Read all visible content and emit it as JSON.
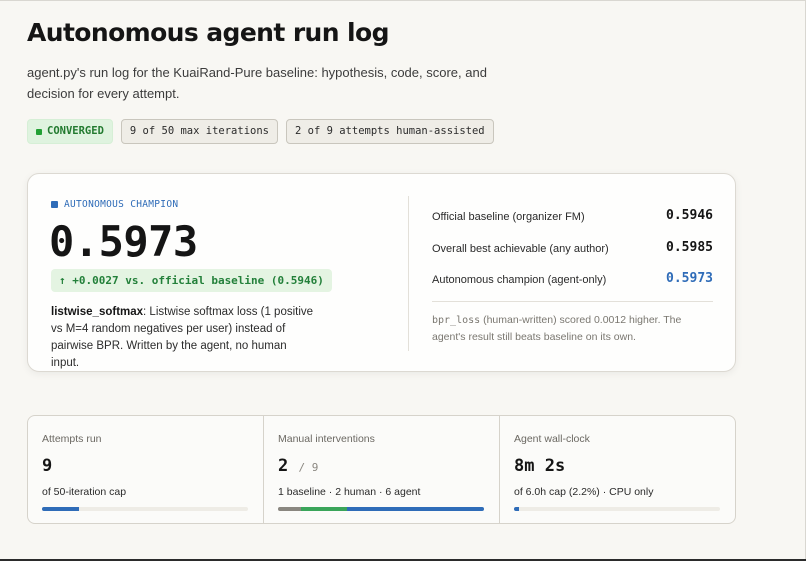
{
  "title": "Autonomous agent run log",
  "subtitle": "agent.py's run log for the KuaiRand-Pure baseline: hypothesis, code, score, and decision for every attempt.",
  "badges": {
    "status": "CONVERGED",
    "iterations": "9 of 50 max iterations",
    "human_assisted": "2 of 9 attempts human-assisted"
  },
  "champion": {
    "label": "AUTONOMOUS CHAMPION",
    "value": "0.5973",
    "delta": "↑ +0.0027 vs. official baseline (0.5946)",
    "method_name": "listwise_softmax",
    "method_desc": ": Listwise softmax loss (1 positive vs M=4 random negatives per user) instead of pairwise BPR. Written by the agent, no human input."
  },
  "comparison": [
    {
      "label": "Official baseline (organizer FM)",
      "value": "0.5946"
    },
    {
      "label": "Overall best achievable (any author)",
      "value": "0.5985"
    },
    {
      "label": "Autonomous champion (agent-only)",
      "value": "0.5973"
    }
  ],
  "note": {
    "code": "bpr_loss",
    "text": " (human-written) scored 0.0012 higher. The agent's result still beats baseline on its own."
  },
  "stats": {
    "attempts": {
      "label": "Attempts run",
      "value": "9",
      "sub": "of 50-iteration cap",
      "progress": 0.18
    },
    "interventions": {
      "label": "Manual interventions",
      "value": "2",
      "of": "/ 9",
      "sub": "1 baseline · 2 human · 6 agent",
      "segments": [
        {
          "name": "baseline",
          "fraction": 0.111,
          "color": "#8a8780"
        },
        {
          "name": "human",
          "fraction": 0.222,
          "color": "#3aa55a"
        },
        {
          "name": "agent",
          "fraction": 0.667,
          "color": "#2f6cb8"
        }
      ]
    },
    "wallclock": {
      "label": "Agent wall-clock",
      "value": "8m 2s",
      "sub": "of 6.0h cap (2.2%) · CPU only",
      "progress": 0.022
    }
  },
  "colors": {
    "accent": "#2f6cb8",
    "success": "#22a034",
    "track": "#eeece6"
  }
}
